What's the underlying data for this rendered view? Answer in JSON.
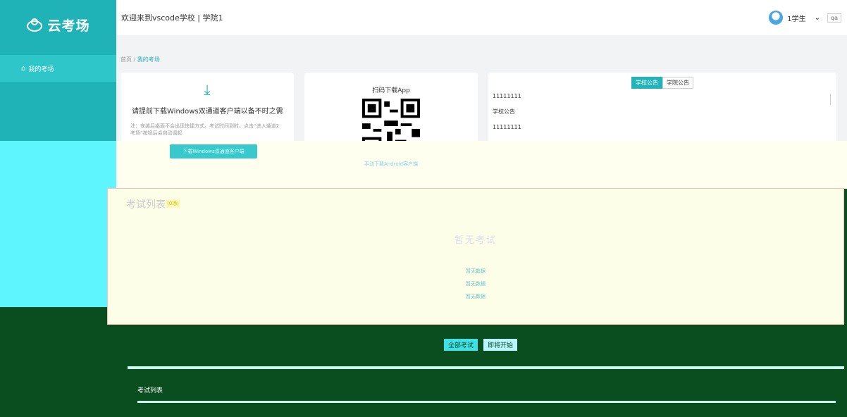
{
  "app": {
    "logo_text": "云考场"
  },
  "sidebar": {
    "items": [
      {
        "label": "我的考场"
      }
    ]
  },
  "header": {
    "title": "欢迎来到vscode学校 | 学院1",
    "user_name": "1学生",
    "lang": "qa"
  },
  "breadcrumb": {
    "home": "首页",
    "sep": "/",
    "current": "我的考场"
  },
  "download_card": {
    "heading": "请提前下载Windows双通道客户端以备不时之需",
    "note": "注：安装后桌面不会出现快捷方式。考试时间到时，点击“进入通道2考场”按钮后会自动调起",
    "button": "下载Windows双通道客户端"
  },
  "app_card": {
    "title": "扫码下载App",
    "link": "手动下载Android客户端"
  },
  "notice_card": {
    "tabs": [
      "学校公告",
      "学院公告"
    ],
    "items": [
      "11111111",
      "学校公告",
      "11111111"
    ]
  },
  "exam": {
    "title": "考试列表",
    "badge": "(0场)",
    "empty": "暂无考试",
    "lines": [
      "暂无数据",
      "暂无数据",
      "暂无数据"
    ]
  },
  "bottom": {
    "selector": [
      "全部考试",
      "即将开始"
    ],
    "item": "考试列表"
  },
  "colors": {
    "accent": "#23b4b9",
    "sidebar": "#1fb3b8"
  }
}
